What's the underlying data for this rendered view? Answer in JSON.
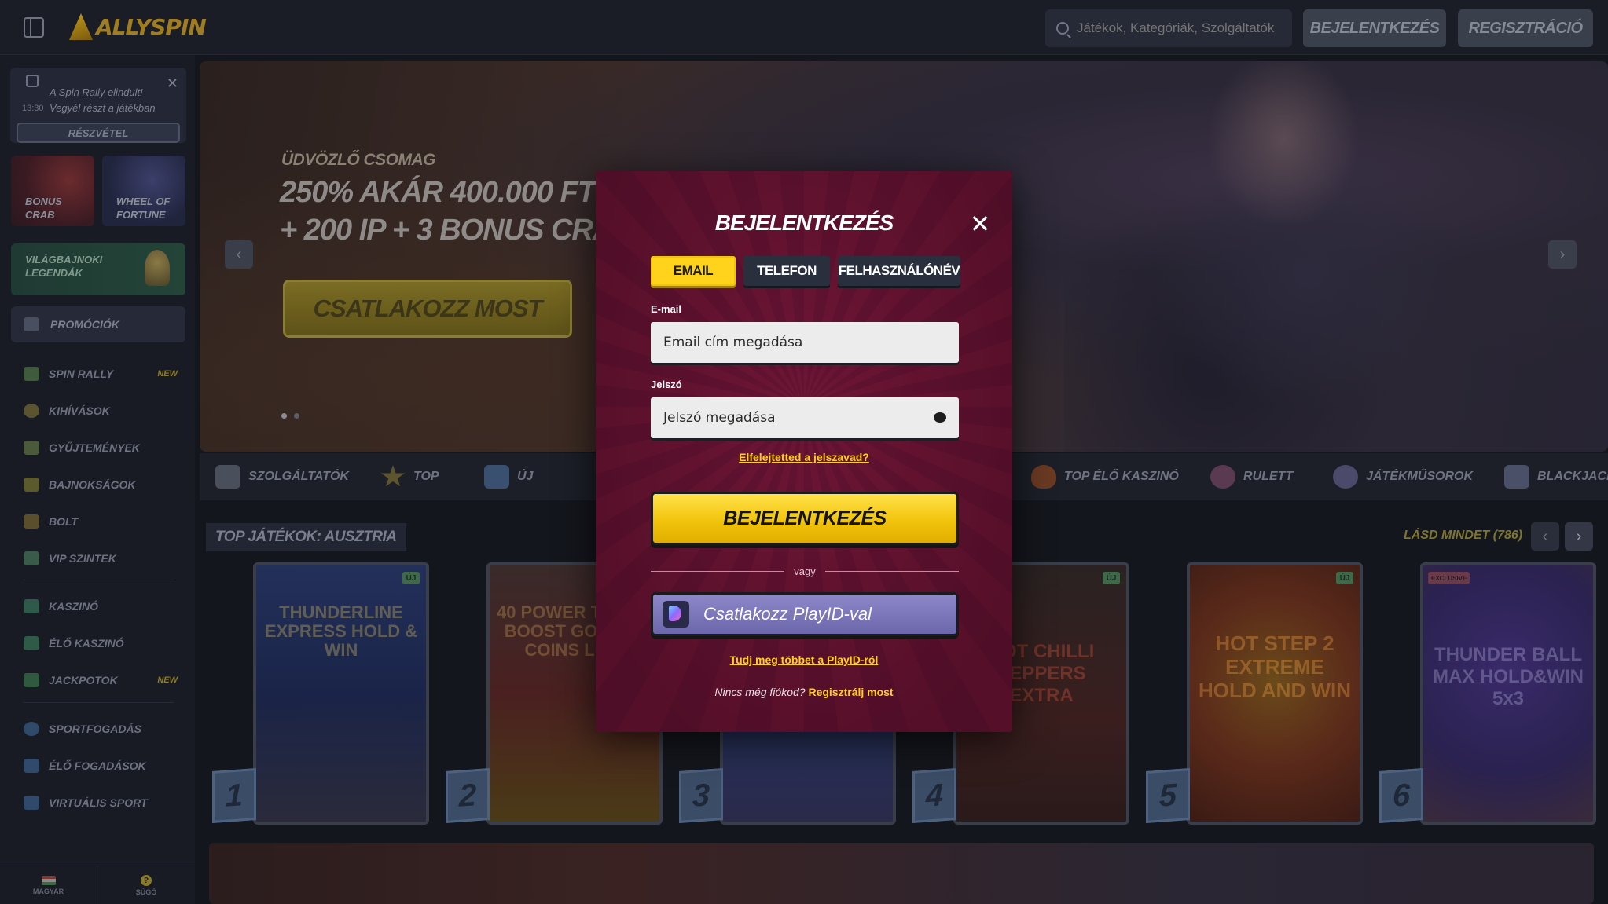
{
  "brand": {
    "logo_text": "ALLYSPIN"
  },
  "header": {
    "search_placeholder": "Játékok, Kategóriák, Szolgáltatók",
    "login_label": "BEJELENTKEZÉS",
    "register_label": "REGISZTRÁCIÓ"
  },
  "sidebar": {
    "rally_card": {
      "title": "A Spin Rally elindult!",
      "subtitle": "Vegyél részt a játékban",
      "time": "13:30",
      "button": "RÉSZVÉTEL"
    },
    "tiles": [
      {
        "label": "BONUS CRAB"
      },
      {
        "label": "WHEEL OF FORTUNE"
      }
    ],
    "world_tile": "VILÁGBAJNOKI LEGENDÁK",
    "promo_label": "PROMÓCIÓK",
    "items": [
      {
        "label": "SPIN RALLY",
        "badge": "NEW"
      },
      {
        "label": "KIHÍVÁSOK",
        "badge": ""
      },
      {
        "label": "GYŰJTEMÉNYEK",
        "badge": ""
      },
      {
        "label": "BAJNOKSÁGOK",
        "badge": ""
      },
      {
        "label": "BOLT",
        "badge": ""
      },
      {
        "label": "VIP SZINTEK",
        "badge": ""
      },
      {
        "label": "KASZINÓ",
        "badge": ""
      },
      {
        "label": "ÉLŐ KASZINÓ",
        "badge": ""
      },
      {
        "label": "JACKPOTOK",
        "badge": "NEW"
      },
      {
        "label": "SPORTFOGADÁS",
        "badge": ""
      },
      {
        "label": "ÉLŐ FOGADÁSOK",
        "badge": ""
      },
      {
        "label": "VIRTUÁLIS SPORT",
        "badge": ""
      }
    ],
    "bottom": {
      "language": "MAGYAR",
      "help": "SÚGÓ"
    }
  },
  "hero": {
    "kicker": "ÜDVÖZLŐ CSOMAG",
    "title_line1": "250% AKÁR 400.000 FT",
    "title_line2": "+ 200 IP + 3 BONUS CRAB",
    "cta": "CSATLAKOZZ MOST",
    "slide_count": 2,
    "active_slide": 1
  },
  "categories": [
    {
      "label": "SZOLGÁLTATÓK"
    },
    {
      "label": "TOP"
    },
    {
      "label": "ÚJ"
    },
    {
      "label": "TOP ÉLŐ KASZINÓ"
    },
    {
      "label": "RULETT"
    },
    {
      "label": "JÁTÉKMŰSOROK"
    },
    {
      "label": "BLACKJACK"
    }
  ],
  "games_section": {
    "title": "TOP JÁTÉKOK: AUSZTRIA",
    "see_all": "LÁSD MINDET (786)",
    "games": [
      {
        "rank": "1",
        "title": "THUNDERLINE EXPRESS HOLD & WIN",
        "badge": "ÚJ"
      },
      {
        "rank": "2",
        "title": "40 POWER TRIPLE BOOST GOLDEN COINS LINK",
        "badge": ""
      },
      {
        "rank": "3",
        "title": "",
        "badge": ""
      },
      {
        "rank": "4",
        "title": "HOT CHILLI PEPPERS EXTRA",
        "badge": "ÚJ"
      },
      {
        "rank": "5",
        "title": "HOT STEP 2 EXTREME HOLD AND WIN",
        "badge": "ÚJ"
      },
      {
        "rank": "6",
        "title": "THUNDER BALL MAX HOLD&WIN 5x3",
        "badge": "EXCLUSIVE"
      }
    ]
  },
  "login_modal": {
    "title": "BEJELENTKEZÉS",
    "tabs": [
      {
        "label": "EMAIL",
        "active": true
      },
      {
        "label": "TELEFON",
        "active": false
      },
      {
        "label": "FELHASZNÁLÓNÉV",
        "active": false
      }
    ],
    "email_label": "E-mail",
    "email_placeholder": "Email cím megadása",
    "password_label": "Jelszó",
    "password_placeholder": "Jelszó megadása",
    "forgot": "Elfelejtetted a jelszavad?",
    "submit": "BEJELENTKEZÉS",
    "or": "vagy",
    "playid_button": "Csatlakozz PlayID-val",
    "playid_learn": "Tudj meg többet a PlayID-ról",
    "no_account": "Nincs még fiókod?",
    "register_link": "Regisztrálj most"
  },
  "colors": {
    "accent_yellow": "#ffd21c",
    "modal_bg": "#6b1533",
    "link_yellow": "#ffcf1a",
    "playid_purple": "#7d78bd"
  }
}
